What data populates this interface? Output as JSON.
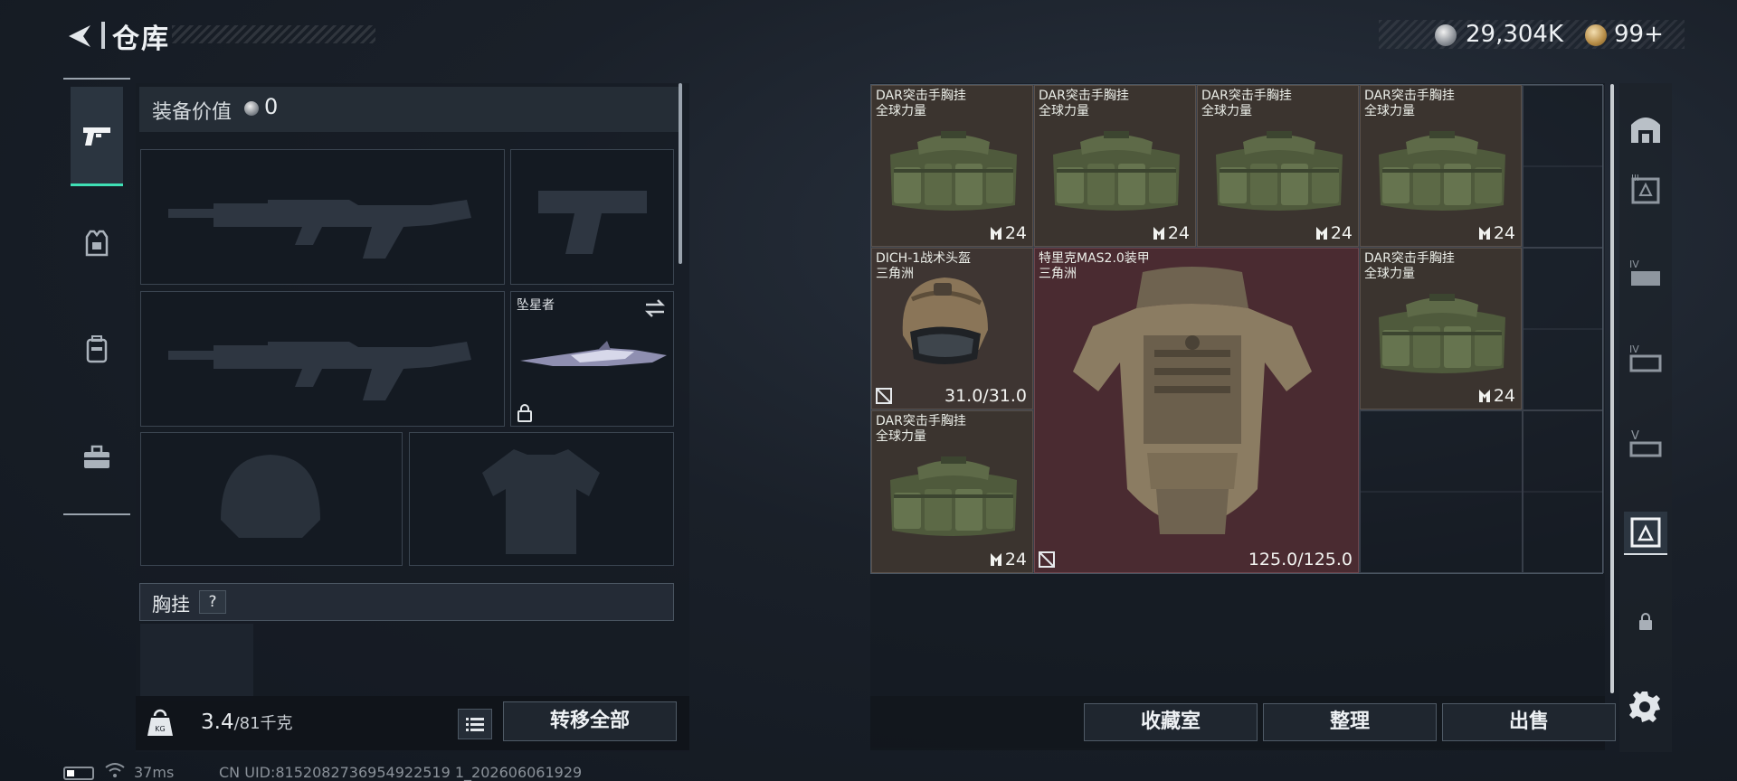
{
  "header": {
    "title": "仓库"
  },
  "currency": {
    "silver": "29,304K",
    "gold": "99+"
  },
  "equipment": {
    "value_label": "装备价值",
    "value": "0",
    "melee_name": "坠星者",
    "section_label": "胸挂",
    "help_mark": "?"
  },
  "footer_left": {
    "weight_current": "3.4",
    "weight_rest": "/81千克",
    "transfer_all": "转移全部"
  },
  "status": {
    "ping": "37ms",
    "uid": "CN UID:8152082736954922519 1_202606061929"
  },
  "storage_items": [
    {
      "name": "DAR突击手胸挂",
      "sub": "全球力量",
      "qty": "24"
    },
    {
      "name": "DAR突击手胸挂",
      "sub": "全球力量",
      "qty": "24"
    },
    {
      "name": "DAR突击手胸挂",
      "sub": "全球力量",
      "qty": "24"
    },
    {
      "name": "DAR突击手胸挂",
      "sub": "全球力量",
      "qty": "24"
    },
    {
      "name": "DICH-1战术头盔",
      "sub": "三角洲",
      "durability": "31.0/31.0"
    },
    {
      "name": "特里克MAS2.0装甲",
      "sub": "三角洲",
      "durability": "125.0/125.0"
    },
    {
      "name": "DAR突击手胸挂",
      "sub": "全球力量",
      "qty": "24"
    },
    {
      "name": "DAR突击手胸挂",
      "sub": "全球力量",
      "qty": "24"
    }
  ],
  "actions": {
    "collection": "收藏室",
    "organize": "整理",
    "sell": "出售"
  },
  "colors": {
    "accent": "#3fe0b5",
    "rig_cell": "#3b342f",
    "armor_cell": "#4a2b31"
  },
  "icons": {
    "left_tabs": [
      "pistol-icon",
      "armor-icon",
      "backpack-icon",
      "toolbox-icon"
    ],
    "right_tabs": [
      "safehouse-icon",
      "storage-tier-3-icon",
      "storage-tier-4-icon",
      "storage-tier-4b-icon",
      "storage-tier-5-icon",
      "storage-expand-icon",
      "lock-icon"
    ]
  }
}
